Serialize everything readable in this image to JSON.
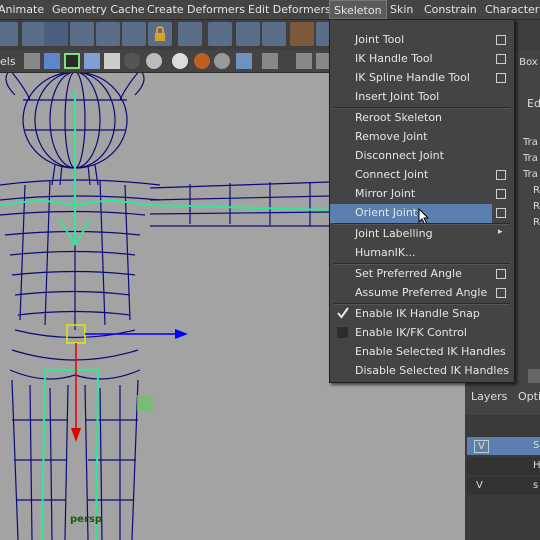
{
  "menubar": {
    "items": [
      "Animate",
      "Geometry Cache",
      "Create Deformers",
      "Edit Deformers",
      "Skeleton",
      "Skin",
      "Constrain",
      "Character"
    ]
  },
  "panel": {
    "label_partial": "els"
  },
  "viewport": {
    "camera_label": "persp"
  },
  "right_panel": {
    "label_box": "el Box",
    "label_edi": "Edi",
    "channels": [
      "Tra",
      "Tra",
      "Tra",
      "R",
      "R",
      "R"
    ],
    "layers_tab": "Layers",
    "options_tab": "Optio",
    "layer_rows": [
      {
        "v": "V",
        "name": "S"
      },
      {
        "v": "",
        "name": "H"
      },
      {
        "v": "V",
        "name": "s"
      }
    ]
  },
  "skeleton_menu": {
    "items": [
      {
        "label": "Joint Tool",
        "option": true
      },
      {
        "label": "IK Handle Tool",
        "option": true
      },
      {
        "label": "IK Spline Handle Tool",
        "option": true
      },
      {
        "label": "Insert Joint Tool",
        "option": false
      },
      {
        "label": "Reroot Skeleton",
        "option": false
      },
      {
        "label": "Remove Joint",
        "option": false
      },
      {
        "label": "Disconnect Joint",
        "option": false
      },
      {
        "label": "Connect Joint",
        "option": true
      },
      {
        "label": "Mirror Joint",
        "option": true
      },
      {
        "label": "Orient Joint",
        "option": true,
        "highlighted": true
      },
      {
        "label": "Joint Labelling",
        "submenu": true
      },
      {
        "label": "HumanIK...",
        "option": false
      },
      {
        "label": "Set Preferred Angle",
        "option": true
      },
      {
        "label": "Assume Preferred Angle",
        "option": true
      },
      {
        "label": "Enable IK Handle Snap",
        "checked": true
      },
      {
        "label": "Enable IK/FK Control",
        "checked": false
      },
      {
        "label": "Enable Selected IK Handles",
        "option": false
      },
      {
        "label": "Disable Selected IK Handles",
        "option": false
      }
    ]
  },
  "colors": {
    "highlight": "#5b7fae",
    "wire": "#0a0a78",
    "skeleton": "#2ee89a",
    "viewport_bg": "#a3a3a3"
  }
}
